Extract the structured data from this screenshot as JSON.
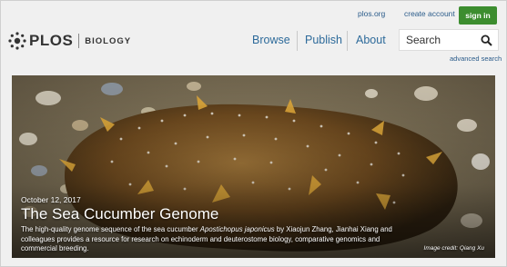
{
  "header": {
    "top_links": {
      "plos_org": "plos.org",
      "create_account": "create account",
      "sign_in": "sign in"
    },
    "logo": {
      "name": "PLOS",
      "journal": "BIOLOGY"
    },
    "nav": [
      {
        "label": "Browse"
      },
      {
        "label": "Publish"
      },
      {
        "label": "About"
      }
    ],
    "search": {
      "placeholder": "Search",
      "advanced": "advanced search"
    }
  },
  "hero": {
    "date": "October 12, 2017",
    "title": "The Sea Cucumber Genome",
    "description_before": "The high-quality genome sequence of the sea cucumber ",
    "description_species": "Apostichopus japonicus",
    "description_after": " by Xiaojun Zhang, Jianhai Xiang and colleagues provides a resource for research on echinoderm and deuterostome biology, comparative genomics and commercial breeding.",
    "credit": "Image credit: Qiang Xu"
  },
  "colors": {
    "link": "#2a5b8a",
    "nav": "#2d6a9a",
    "signin_bg": "#3c8d2f",
    "page_bg": "#f0f0f0"
  }
}
